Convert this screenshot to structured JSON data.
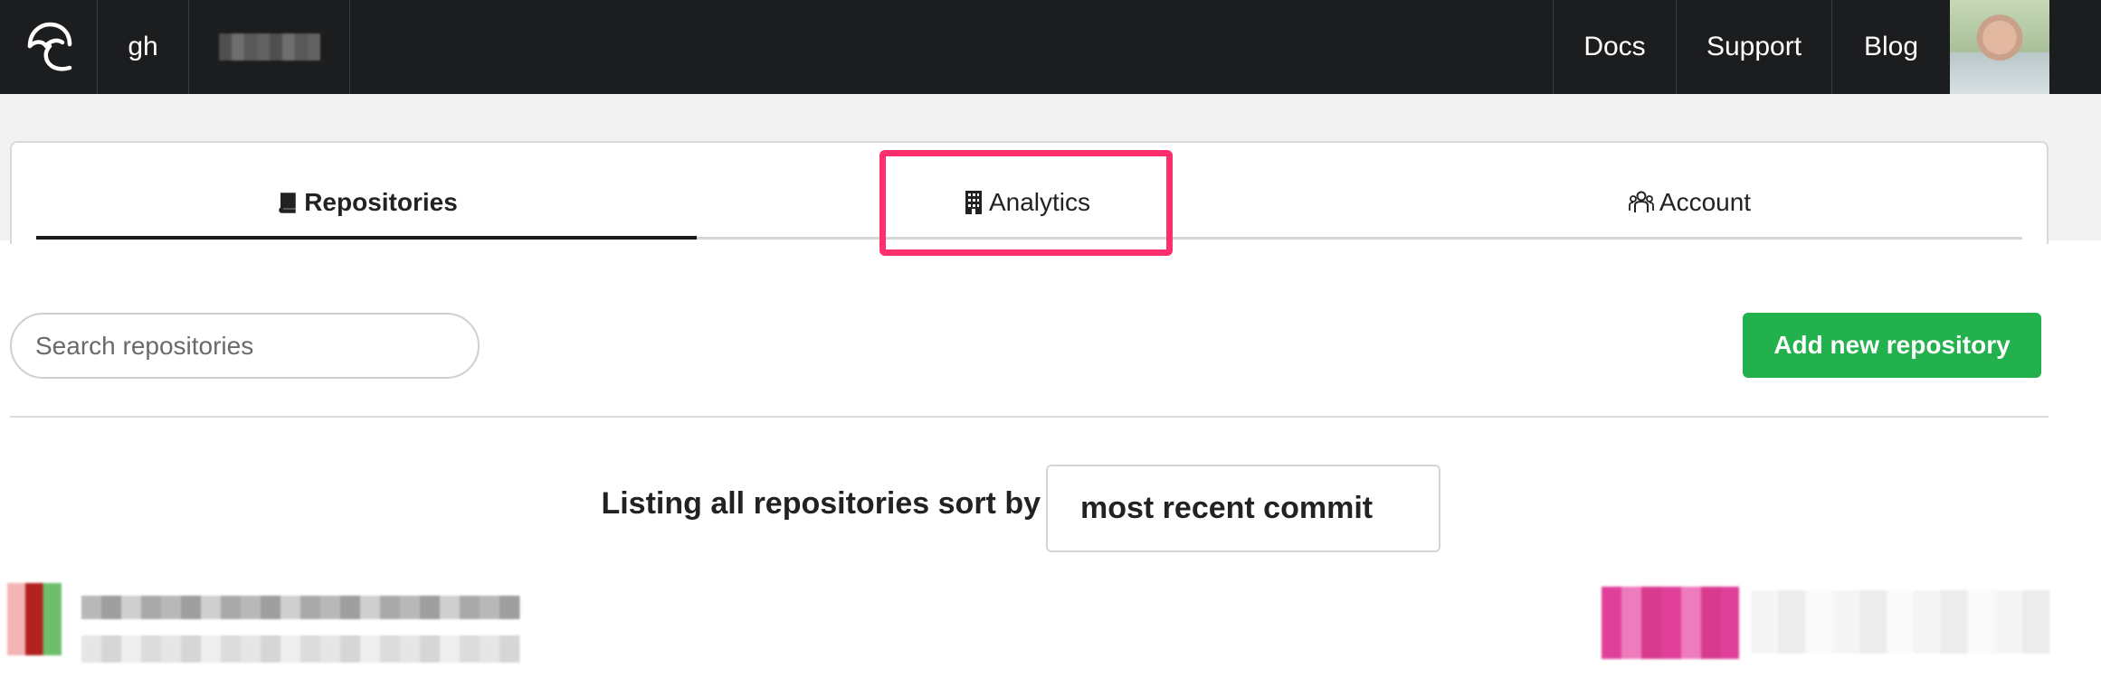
{
  "navbar": {
    "org_label": "gh",
    "links": {
      "docs": "Docs",
      "support": "Support",
      "blog": "Blog"
    },
    "logo_icon": "umbrella-logo-icon"
  },
  "tabs": {
    "repositories": "Repositories",
    "analytics": "Analytics",
    "account": "Account",
    "active": "repositories",
    "icons": {
      "repositories": "book-icon",
      "analytics": "building-icon",
      "account": "users-icon"
    }
  },
  "search": {
    "placeholder": "Search repositories",
    "value": ""
  },
  "add_button": {
    "label": "Add new repository",
    "color": "#22b14c"
  },
  "sort": {
    "label": "Listing all repositories sort by",
    "selected": "most recent commit"
  },
  "colors": {
    "navbar_bg": "#1c1d1f",
    "highlight": "#ff2f6e",
    "active_tab_underline": "#1a1a1a"
  }
}
